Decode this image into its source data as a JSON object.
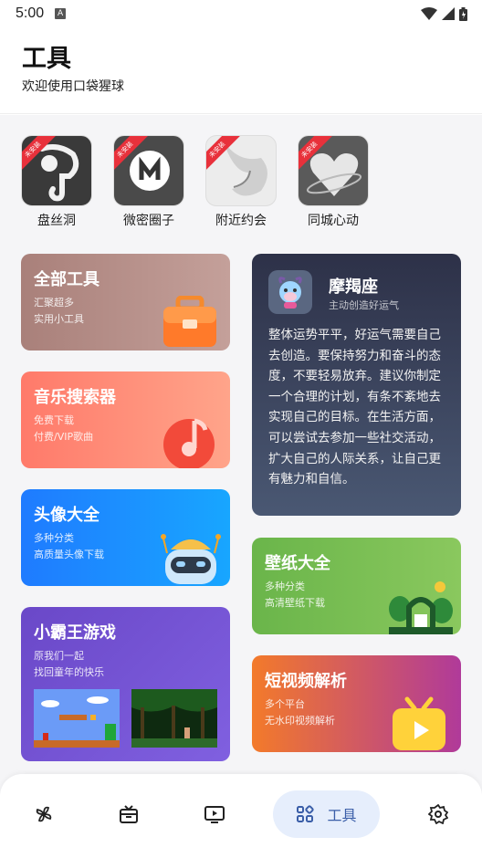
{
  "status": {
    "time": "5:00",
    "badge": "A"
  },
  "header": {
    "title": "工具",
    "subtitle": "欢迎使用口袋猩球"
  },
  "apps": [
    {
      "label": "盘丝洞",
      "ribbon": "未安装"
    },
    {
      "label": "微密圈子",
      "ribbon": "未安装"
    },
    {
      "label": "附近约会",
      "ribbon": "未安装"
    },
    {
      "label": "同城心动",
      "ribbon": "未安装"
    }
  ],
  "cards": {
    "all_tools": {
      "title": "全部工具",
      "line1": "汇聚超多",
      "line2": "实用小工具"
    },
    "music": {
      "title": "音乐搜索器",
      "line1": "免费下载",
      "line2": "付费/VIP歌曲"
    },
    "avatar": {
      "title": "头像大全",
      "line1": "多种分类",
      "line2": "高质量头像下载"
    },
    "game": {
      "title": "小霸王游戏",
      "line1": "原我们一起",
      "line2": "找回童年的快乐"
    },
    "zodiac": {
      "name": "摩羯座",
      "sub": "主动创造好运气",
      "text": "整体运势平平，好运气需要自己去创造。要保持努力和奋斗的态度，不要轻易放弃。建议你制定一个合理的计划，有条不紊地去实现自己的目标。在生活方面，可以尝试去参加一些社交活动，扩大自己的人际关系，让自己更有魅力和自信。"
    },
    "wallpaper": {
      "title": "壁纸大全",
      "line1": "多种分类",
      "line2": "高清壁纸下载"
    },
    "video": {
      "title": "短视频解析",
      "line1": "多个平台",
      "line2": "无水印视频解析"
    }
  },
  "nav": {
    "active_label": "工具",
    "accent": "#3a5ea8"
  }
}
